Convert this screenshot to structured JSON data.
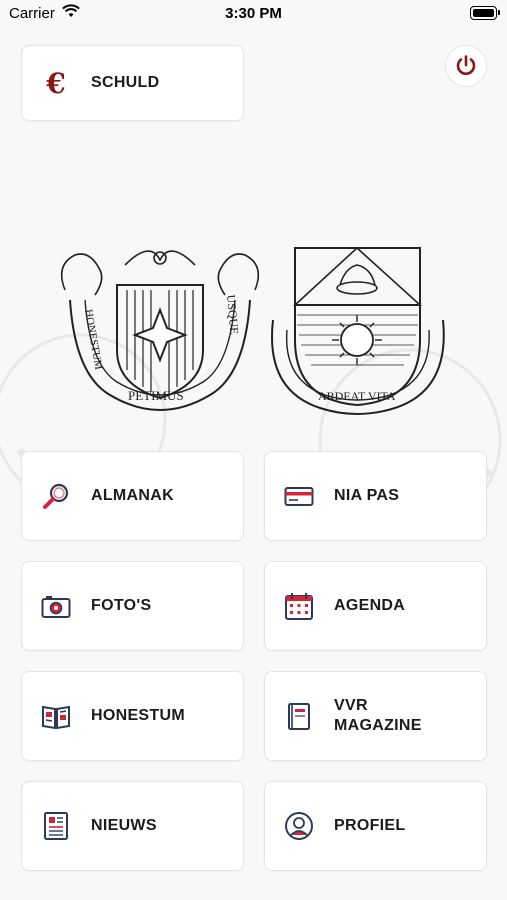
{
  "status_bar": {
    "carrier": "Carrier",
    "time": "3:30 PM",
    "icons": [
      "wifi-icon",
      "battery-icon"
    ]
  },
  "header": {
    "debt_button": {
      "label": "SCHULD",
      "icon": "euro-icon"
    },
    "logout_button": {
      "icon": "power-icon"
    }
  },
  "crests": {
    "left": {
      "motto_top": "HONESTUM",
      "motto_right": "USQUE",
      "motto_bottom": "PETIMUS"
    },
    "right": {
      "motto": "ARDEAT VITA"
    }
  },
  "menu": [
    {
      "label": "ALMANAK",
      "icon": "search-icon"
    },
    {
      "label": "NIA PAS",
      "icon": "card-icon"
    },
    {
      "label": "FOTO'S",
      "icon": "camera-icon"
    },
    {
      "label": "AGENDA",
      "icon": "calendar-icon"
    },
    {
      "label": "HONESTUM",
      "icon": "book-icon"
    },
    {
      "label": "VVR\nMAGAZINE",
      "icon": "magazine-icon"
    },
    {
      "label": "NIEUWS",
      "icon": "newspaper-icon"
    },
    {
      "label": "PROFIEL",
      "icon": "profile-icon"
    }
  ],
  "colors": {
    "accent": "#8a1616",
    "icon_navy": "#2d3a56",
    "icon_red": "#d1263a",
    "background": "#f7f8fa"
  }
}
